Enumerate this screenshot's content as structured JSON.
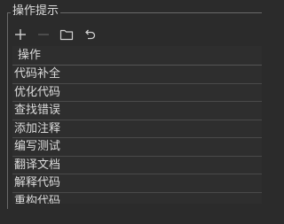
{
  "group": {
    "title": "操作提示"
  },
  "toolbar": {
    "add_icon": "plus-icon",
    "remove_icon": "minus-icon",
    "open_icon": "folder-icon",
    "reset_icon": "undo-icon"
  },
  "list": {
    "header": "操作",
    "items": [
      "代码补全",
      "优化代码",
      "查找错误",
      "添加注释",
      "编写测试",
      "翻译文档",
      "解释代码",
      "重构代码"
    ]
  },
  "colors": {
    "background": "#2b2b2b",
    "border": "#6a6a6a",
    "text": "#dcdcdc",
    "icon": "#d0d0d0",
    "icon_disabled": "#5a5a5a"
  }
}
